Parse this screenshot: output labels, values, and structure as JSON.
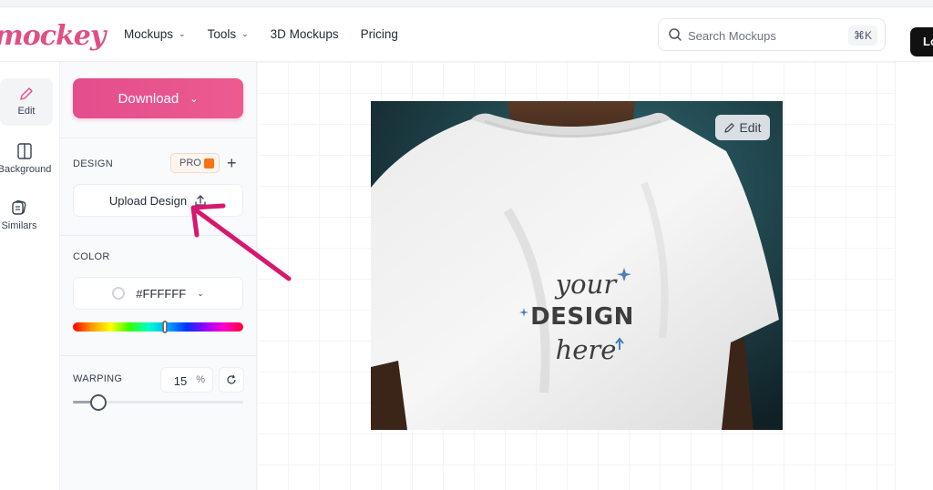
{
  "header": {
    "logo": "mockey",
    "nav": [
      {
        "label": "Mockups",
        "has_dropdown": true
      },
      {
        "label": "Tools",
        "has_dropdown": true
      },
      {
        "label": "3D Mockups",
        "has_dropdown": false
      },
      {
        "label": "Pricing",
        "has_dropdown": false
      }
    ],
    "search": {
      "placeholder": "Search Mockups",
      "shortcut": "⌘K",
      "icon": "search-icon"
    },
    "login_label": "Lo"
  },
  "rail": {
    "items": [
      {
        "label": "Edit",
        "icon": "pencil-icon",
        "active": true
      },
      {
        "label": "Background",
        "icon": "background-icon",
        "active": false
      },
      {
        "label": "Similars",
        "icon": "similars-icon",
        "active": false
      }
    ]
  },
  "panel": {
    "download_label": "Download",
    "design": {
      "label": "DESIGN",
      "pro_badge": "PRO",
      "upload_label": "Upload Design"
    },
    "color": {
      "label": "COLOR",
      "value": "#FFFFFF",
      "hue_position": 0.54
    },
    "warping": {
      "label": "WARPING",
      "value": "15",
      "unit": "%",
      "slider_fraction": 0.15
    }
  },
  "canvas": {
    "edit_label": "Edit",
    "design_placeholder": {
      "line1": "your",
      "line2": "DESIGN",
      "line3": "here"
    },
    "colors": {
      "accent": "#e44d8c",
      "annotation_arrow": "#d6186f",
      "star": "#4a7fb8"
    }
  }
}
